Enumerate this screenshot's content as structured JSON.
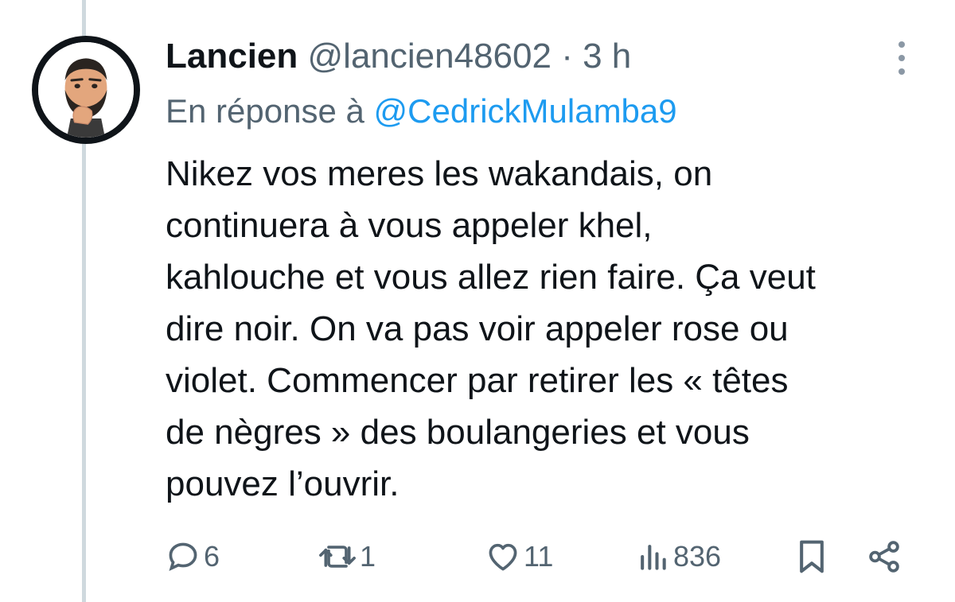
{
  "tweet": {
    "display_name": "Lancien",
    "handle": "@lancien48602",
    "separator": "·",
    "time": "3 h",
    "reply_prefix": "En réponse à",
    "reply_to": "@CedrickMulamba9",
    "text_lines": [
      "Nikez vos meres les wakandais, on",
      "continuera à vous appeler khel,",
      "kahlouche et vous allez rien faire. Ça veut",
      "dire noir. On va pas voir appeler rose ou",
      "violet. Commencer par retirer les « têtes",
      "de nègres » des boulangeries et vous",
      "pouvez l’ouvrir."
    ]
  },
  "actions": {
    "replies": "6",
    "retweets": "1",
    "likes": "11",
    "views": "836"
  },
  "icons": {
    "reply": "reply-icon",
    "retweet": "retweet-icon",
    "like": "heart-icon",
    "views": "views-icon",
    "bookmark": "bookmark-icon",
    "share": "share-icon",
    "more": "more-vertical-icon"
  },
  "colors": {
    "text": "#0f1419",
    "secondary": "#536471",
    "link": "#1d9bf0",
    "thread_line": "#cfd9de"
  }
}
